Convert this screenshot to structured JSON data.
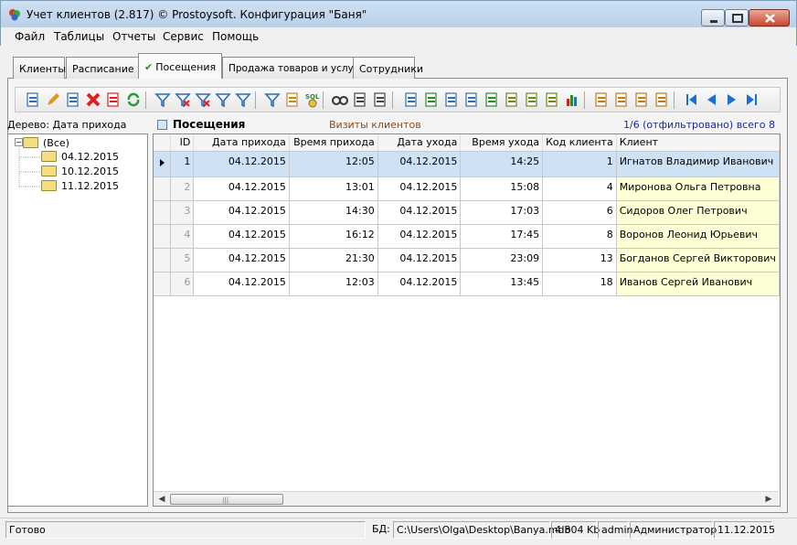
{
  "window": {
    "title": "Учет клиентов (2.817) © Prostoysoft. Конфигурация \"Баня\""
  },
  "menu": [
    "Файл",
    "Таблицы",
    "Отчеты",
    "Сервис",
    "Помощь"
  ],
  "tabs": [
    {
      "label": "Клиенты",
      "active": false
    },
    {
      "label": "Расписание",
      "active": false
    },
    {
      "label": "Посещения",
      "active": true,
      "checked": true
    },
    {
      "label": "Продажа товаров и услуг",
      "active": false
    },
    {
      "label": "Сотрудники",
      "active": false
    }
  ],
  "toolbar": {
    "icons": [
      "new-record-icon",
      "edit-icon",
      "copy-record-icon",
      "delete-icon",
      "delete-multiple-icon",
      "refresh-icon",
      "filter-icon",
      "filter-clear-icon",
      "filter-remove-icon",
      "filter-quick-icon",
      "filter-settings-icon",
      "filter-active-icon",
      "tree-toggle-icon",
      "sql-filter-icon",
      "find-icon",
      "print-icon",
      "print-preview-icon",
      "export-word-icon",
      "export-excel-icon",
      "export-html-icon",
      "export-word2-icon",
      "export-excel2-icon",
      "export-xml-icon",
      "export-csv-icon",
      "export-txt-icon",
      "chart-icon",
      "sort-ascending-icon",
      "sort-settings-icon",
      "columns-icon",
      "report-icon",
      "first-record-icon",
      "previous-record-icon",
      "next-record-icon",
      "last-record-icon"
    ],
    "sql_label": "SQL"
  },
  "tree": {
    "label": "Дерево: Дата прихода",
    "root": "(Все)",
    "children": [
      "04.12.2015",
      "10.12.2015",
      "11.12.2015"
    ]
  },
  "grid": {
    "title": "Посещения",
    "subtitle": "Визиты клиентов",
    "summary": "1/6 (отфильтровано) всего 8",
    "columns": [
      "ID",
      "Дата прихода",
      "Время прихода",
      "Дата ухода",
      "Время ухода",
      "Код клиента",
      "Клиент"
    ],
    "rows": [
      [
        "1",
        "04.12.2015",
        "12:05",
        "04.12.2015",
        "14:25",
        "1",
        "Игнатов Владимир Иванович"
      ],
      [
        "2",
        "04.12.2015",
        "13:01",
        "04.12.2015",
        "15:08",
        "4",
        "Миронова Ольга Петровна"
      ],
      [
        "3",
        "04.12.2015",
        "14:30",
        "04.12.2015",
        "17:03",
        "6",
        "Сидоров Олег Петрович"
      ],
      [
        "4",
        "04.12.2015",
        "16:12",
        "04.12.2015",
        "17:45",
        "8",
        "Воронов Леонид Юрьевич"
      ],
      [
        "5",
        "04.12.2015",
        "21:30",
        "04.12.2015",
        "23:09",
        "13",
        "Богданов Сергей Викторович"
      ],
      [
        "6",
        "04.12.2015",
        "12:03",
        "04.12.2015",
        "13:45",
        "18",
        "Иванов Сергей Иванович"
      ]
    ],
    "selected_row": 0
  },
  "statusbar": {
    "status": "Готово",
    "db_label": "БД:",
    "db_path": "C:\\Users\\Olga\\Desktop\\Banya.mdb",
    "db_size": "4 804 Kb",
    "user": "admin",
    "role": "Администратор",
    "date": "11.12.2015"
  }
}
